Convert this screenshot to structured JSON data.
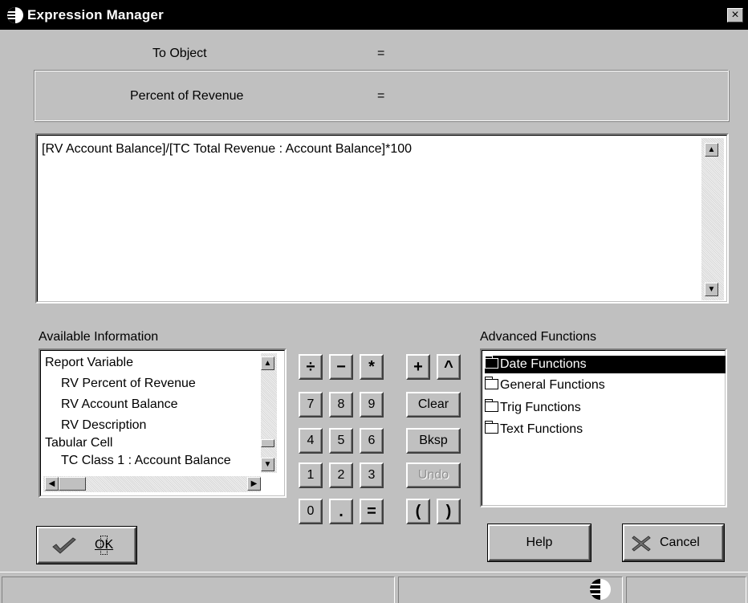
{
  "window": {
    "title": "Expression Manager",
    "close_label": "×"
  },
  "target": {
    "object_label": "To Object",
    "object_equals": "=",
    "field_label": "Percent of Revenue",
    "field_equals": "="
  },
  "expression": {
    "text": "[RV Account Balance]/[TC Total Revenue : Account Balance]*100"
  },
  "available_info": {
    "label": "Available Information",
    "items": [
      "Report Variable",
      "RV Percent of Revenue",
      "RV Account Balance",
      "RV Description",
      "Tabular Cell",
      "TC Class 1 : Account Balance"
    ]
  },
  "calculator": {
    "row1": [
      "÷",
      "−",
      "*",
      "+",
      "^"
    ],
    "row2": [
      "7",
      "8",
      "9",
      "Clear"
    ],
    "row3": [
      "4",
      "5",
      "6",
      "Bksp"
    ],
    "row4": [
      "1",
      "2",
      "3",
      "Undo"
    ],
    "row5": [
      "0",
      ".",
      "=",
      "(",
      ")"
    ],
    "disabled": [
      "Undo"
    ]
  },
  "advanced_functions": {
    "label": "Advanced Functions",
    "items": [
      "Date Functions",
      "General Functions",
      "Trig Functions",
      "Text Functions"
    ],
    "selected": "Date Functions"
  },
  "buttons": {
    "ok": "OK",
    "help": "Help",
    "cancel": "Cancel"
  },
  "icons": [
    "app-globe-icon",
    "close-icon",
    "checkmark-icon",
    "cancel-x-icon",
    "folder-icon",
    "status-globe-icon"
  ]
}
